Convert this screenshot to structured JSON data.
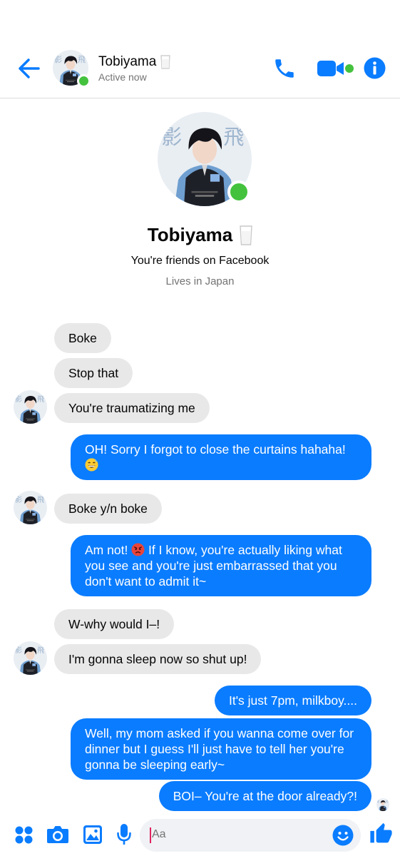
{
  "header": {
    "contact_name": "Tobiyama",
    "status": "Active now"
  },
  "profile": {
    "name": "Tobiyama",
    "friends_line": "You're friends on Facebook",
    "location": "Lives in Japan"
  },
  "messages": [
    {
      "from": "them",
      "text": "Boke"
    },
    {
      "from": "them",
      "text": "Stop that"
    },
    {
      "from": "them",
      "text": "You're traumatizing me"
    },
    {
      "from": "me",
      "text": "OH! Sorry I forgot to close the curtains hahaha!",
      "emoji": "grinning-sweat"
    },
    {
      "from": "them",
      "text": "Boke y/n boke"
    },
    {
      "from": "me",
      "text_before": "Am not! ",
      "emoji": "angry-face",
      "text_after": " If I know, you're actually liking what you see and you're just embarrassed that you don't want to admit it~"
    },
    {
      "from": "them",
      "text": "W-why would I–!"
    },
    {
      "from": "them",
      "text": "I'm gonna sleep now so shut up!"
    },
    {
      "from": "me",
      "text": "It's just 7pm, milkboy...."
    },
    {
      "from": "me",
      "text": "Well, my mom asked if you wanna come over for dinner but I guess I'll just have to tell her you're gonna be sleeping early~"
    },
    {
      "from": "me",
      "text": "BOI– You're at the door already?!"
    }
  ],
  "composer": {
    "placeholder": "Aa"
  },
  "icons": {
    "back": "arrow-left-icon",
    "call": "phone-icon",
    "video": "video-camera-icon",
    "info": "info-icon",
    "apps": "four-dots-icon",
    "camera": "camera-icon",
    "gallery": "image-icon",
    "mic": "microphone-icon",
    "emoji": "smiley-icon",
    "like": "thumbs-up-icon",
    "name_badge": "milk-glass-icon"
  },
  "colors": {
    "accent": "#0a7cff",
    "incoming_bubble": "#e8e8e8",
    "online": "#44c23e",
    "secondary_text": "#737373"
  }
}
